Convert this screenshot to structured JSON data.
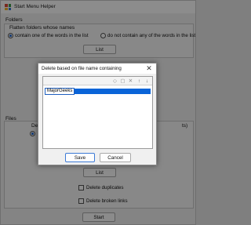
{
  "window": {
    "title": "Start Menu Helper"
  },
  "folders": {
    "heading": "Folders",
    "flatten_label": "Flatten folders whose names",
    "option_contain": "contain one of the words in the list",
    "option_not_contain": "do not contain any of the words in the list",
    "list_button": "List"
  },
  "files": {
    "heading": "Files",
    "partial_text_1": "Dele",
    "partial_text_2": "ts)",
    "list_button": "List",
    "delete_duplicates": "Delete duplicates",
    "delete_broken_links": "Delete broken links"
  },
  "start_button": "Start",
  "dialog": {
    "title": "Delete based on file name containing",
    "entry_value": "MajorGeeks",
    "save_button": "Save",
    "cancel_button": "Cancel",
    "close_glyph": "✕",
    "toolbar_icons": [
      "new-icon",
      "duplicate-icon",
      "delete-icon",
      "move-up-icon",
      "move-down-icon"
    ],
    "toolbar_glyphs": [
      "◇",
      "▢",
      "✕",
      "↑",
      "↓"
    ]
  },
  "colors": {
    "selection": "#0a64d8",
    "primary_border": "#3c7ad6",
    "app_icon": [
      "#d94b3a",
      "#3b9b4a",
      "#f2b431",
      "#3a78d4"
    ]
  }
}
